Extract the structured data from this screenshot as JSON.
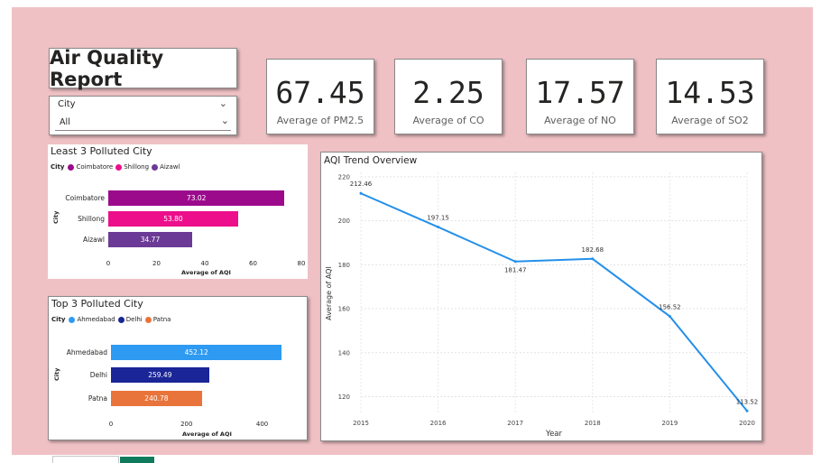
{
  "report": {
    "title": "Air Quality Report",
    "background": "#efc1c5"
  },
  "slicer": {
    "label": "City",
    "value": "All"
  },
  "kpis": [
    {
      "value": "67.45",
      "label": "Average of PM2.5"
    },
    {
      "value": "2.25",
      "label": "Average of CO"
    },
    {
      "value": "17.57",
      "label": "Average of NO"
    },
    {
      "value": "14.53",
      "label": "Average of SO2"
    }
  ],
  "chart_data": [
    {
      "type": "bar",
      "orientation": "horizontal",
      "title": "Least 3 Polluted City",
      "legend_title": "City",
      "categories": [
        "Coimbatore",
        "Shillong",
        "Aizawl"
      ],
      "values": [
        73.02,
        53.8
      ],
      "value_labels": [
        "73.02",
        "53.80",
        "34.77"
      ],
      "colors": [
        "#9c0a8c",
        "#ec0e8b",
        "#6b3a96"
      ],
      "xlabel": "Average of AQI",
      "ylabel": "City",
      "xticks": [
        "0",
        "20",
        "40",
        "60",
        "80"
      ],
      "xlim": [
        0,
        80
      ],
      "grid": false,
      "legend_position": "top-left"
    },
    {
      "type": "bar",
      "orientation": "horizontal",
      "title": "Top 3 Polluted City",
      "legend_title": "City",
      "categories": [
        "Ahmedabad",
        "Delhi",
        "Patna"
      ],
      "values": [
        452.12,
        259.49,
        240.78
      ],
      "value_labels": [
        "452.12",
        "259.49",
        "240.78"
      ],
      "colors": [
        "#2e9af2",
        "#1a2597",
        "#e8743b"
      ],
      "xlabel": "Average of AQI",
      "ylabel": "City",
      "xticks": [
        "0",
        "200",
        "400"
      ],
      "xlim": [
        0,
        530
      ],
      "grid": false,
      "legend_position": "top-left"
    },
    {
      "type": "line",
      "title": "AQI Trend Overview",
      "x": [
        2015,
        2016,
        2017,
        2018,
        2019,
        2020
      ],
      "y": [
        212.46,
        197.15,
        181.47,
        182.68,
        156.52,
        113.52
      ],
      "labels": [
        "212.46",
        "197.15",
        "181.47",
        "182.68",
        "156.52",
        "113.52"
      ],
      "xticks": [
        "2015",
        "2016",
        "2017",
        "2018",
        "2019",
        "2020"
      ],
      "yticks": [
        "120",
        "140",
        "160",
        "180",
        "200",
        "220"
      ],
      "ylim": [
        112,
        222
      ],
      "xlabel": "Year",
      "ylabel": "Average of AQI",
      "color": "#2490ea",
      "grid": true
    }
  ]
}
